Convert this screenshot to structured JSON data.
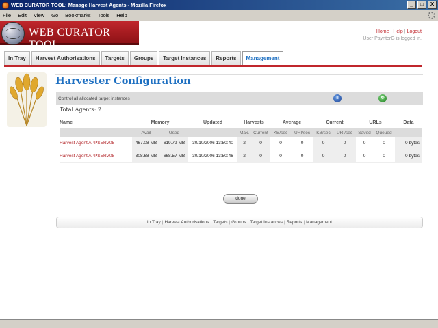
{
  "window": {
    "title": "WEB CURATOR TOOL: Manage Harvest Agents - Mozilla Firefox",
    "minimize": "_",
    "maximize": "□",
    "close": "X"
  },
  "menu": [
    "File",
    "Edit",
    "View",
    "Go",
    "Bookmarks",
    "Tools",
    "Help"
  ],
  "header": {
    "logo_text": "WEB CURATOR TOOL",
    "links": [
      "Home",
      "Help",
      "Logout"
    ],
    "logged_in": "User PaynterG is logged in."
  },
  "tabs": [
    {
      "label": "In Tray",
      "active": false
    },
    {
      "label": "Harvest Authorisations",
      "active": false
    },
    {
      "label": "Targets",
      "active": false
    },
    {
      "label": "Groups",
      "active": false
    },
    {
      "label": "Target Instances",
      "active": false
    },
    {
      "label": "Reports",
      "active": false
    },
    {
      "label": "Management",
      "active": true
    }
  ],
  "main": {
    "title": "Harvester Configuration",
    "control_text": "Control all allocated target instances",
    "pause_symbol": "II",
    "resume_symbol": "↻",
    "total_agents": "Total Agents: 2",
    "done_label": "done"
  },
  "table": {
    "headers": {
      "name": "Name",
      "memory": "Memory",
      "updated": "Updated",
      "harvests": "Harvests",
      "average": "Average",
      "current": "Current",
      "urls": "URLs",
      "data": "Data"
    },
    "subheaders": {
      "avail": "Avail",
      "used": "Used",
      "max": "Max.",
      "current": "Current",
      "avg_kb": "KB/sec",
      "avg_uri": "URI/sec",
      "cur_kb": "KB/sec",
      "cur_uri": "URI/sec",
      "saved": "Saved",
      "queued": "Queued"
    },
    "rows": [
      {
        "name": "Harvest Agent APPSERV05",
        "avail": "467.08 MB",
        "used": "619.79 MB",
        "updated": "30/10/2006 13:50:40",
        "max": "2",
        "current": "0",
        "avg_kb": "0",
        "avg_uri": "0",
        "cur_kb": "0",
        "cur_uri": "0",
        "saved": "0",
        "queued": "0",
        "data": "0 bytes"
      },
      {
        "name": "Harvest Agent APPSERV08",
        "avail": "308.68 MB",
        "used": "668.57 MB",
        "updated": "30/10/2006 13:50:46",
        "max": "2",
        "current": "0",
        "avg_kb": "0",
        "avg_uri": "0",
        "cur_kb": "0",
        "cur_uri": "0",
        "saved": "0",
        "queued": "0",
        "data": "0 bytes"
      }
    ]
  },
  "footer_links": [
    "In Tray",
    "Harvest Authorisations",
    "Targets",
    "Groups",
    "Target Instances",
    "Reports",
    "Management"
  ],
  "colors": {
    "accent_blue": "#1d6fc1",
    "brand_red": "#c0262c",
    "titlebar": "#0a246a"
  }
}
